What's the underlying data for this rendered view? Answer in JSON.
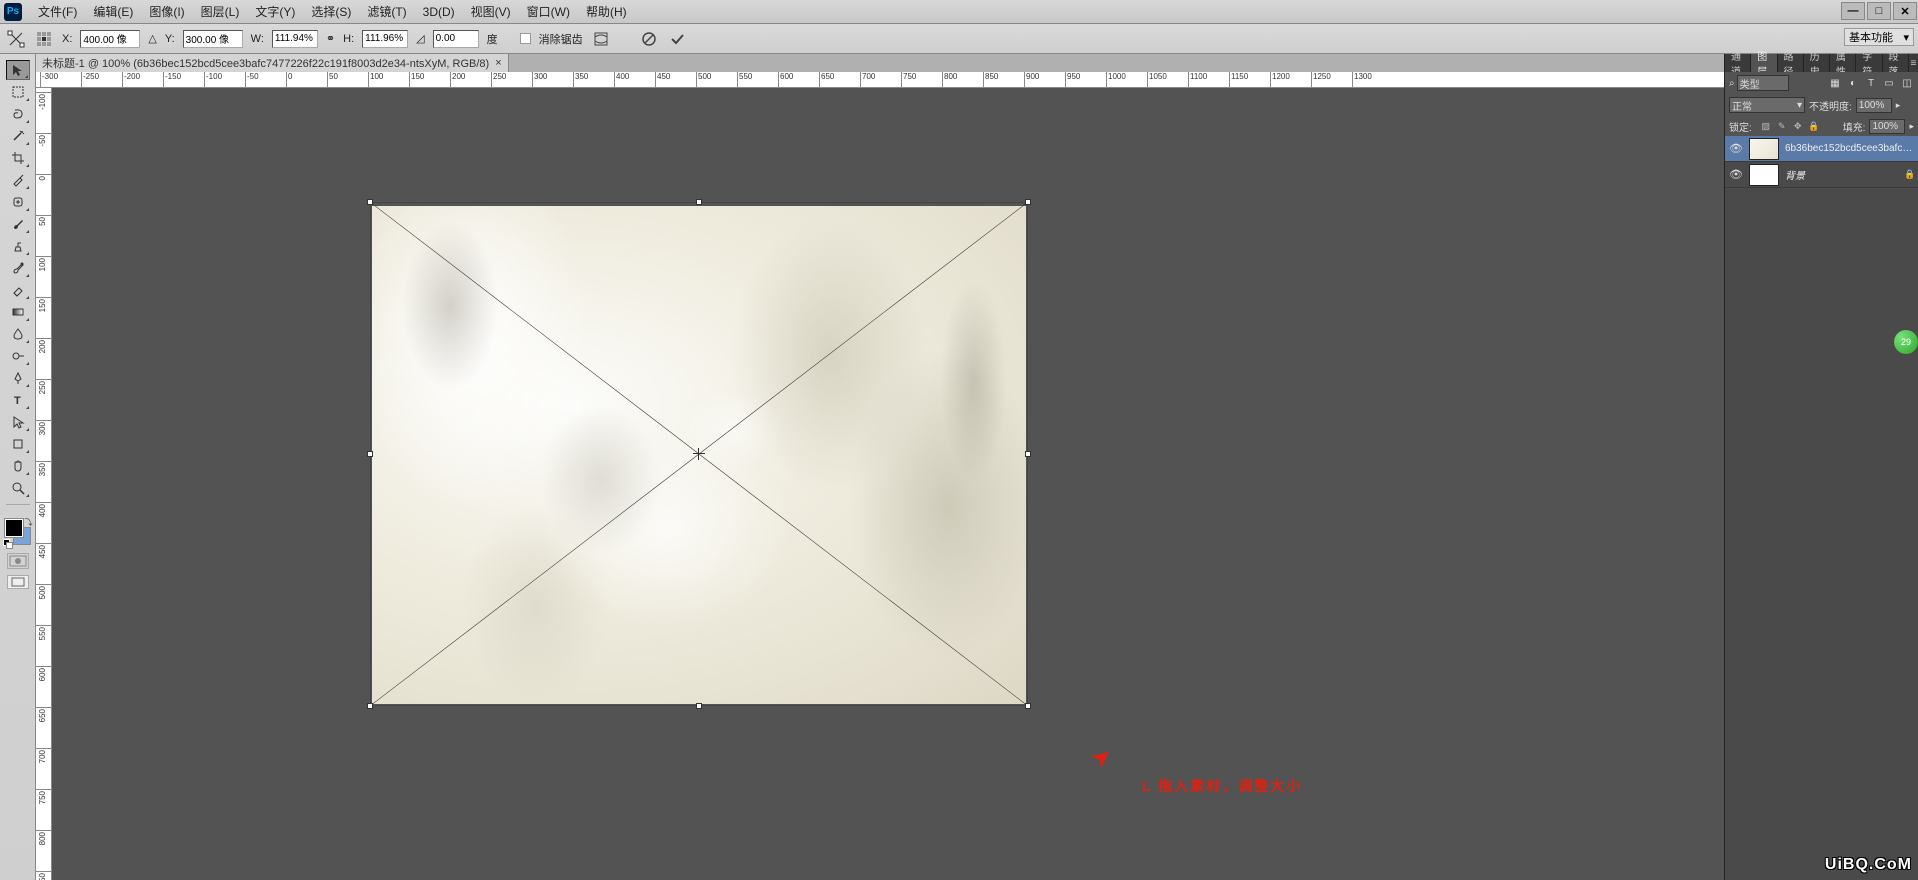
{
  "menubar": {
    "items": [
      "文件(F)",
      "编辑(E)",
      "图像(I)",
      "图层(L)",
      "文字(Y)",
      "选择(S)",
      "滤镜(T)",
      "3D(D)",
      "视图(V)",
      "窗口(W)",
      "帮助(H)"
    ]
  },
  "optionsbar": {
    "x_label": "X:",
    "x_value": "400.00 像",
    "y_label": "Y:",
    "y_value": "300.00 像",
    "w_label": "W:",
    "w_value": "111.94%",
    "h_label": "H:",
    "h_value": "111.96%",
    "angle_value": "0.00",
    "angle_unit": "度",
    "antialias_label": "消除锯齿",
    "workspace": "基本功能"
  },
  "doctab": {
    "title": "未标题-1 @ 100% (6b36bec152bcd5cee3bafc7477226f22c191f8003d2e34-ntsXyM, RGB/8)"
  },
  "ruler": {
    "marks": [
      "-300",
      "-250",
      "-200",
      "-150",
      "-100",
      "-50",
      "0",
      "50",
      "100",
      "150",
      "200",
      "250",
      "300",
      "350",
      "400",
      "450",
      "500",
      "550",
      "600",
      "650",
      "700",
      "750",
      "800",
      "850",
      "900",
      "950",
      "1000",
      "1050",
      "1100",
      "1150",
      "1200",
      "1250",
      "1300"
    ]
  },
  "panels": {
    "tabrow1": [
      "通道",
      "图层",
      "路径",
      "历史",
      "属性",
      "字符",
      "段落"
    ],
    "active_tab": "图层",
    "filter_type": "类型",
    "blend_mode": "正常",
    "opacity_label": "不透明度:",
    "opacity_value": "100%",
    "lock_label": "锁定:",
    "fill_label": "填充:",
    "fill_value": "100%",
    "layers": [
      {
        "name": "6b36bec152bcd5cee3bafc7...",
        "selected": true,
        "visible": true,
        "locked": false
      },
      {
        "name": "背景",
        "selected": false,
        "visible": true,
        "locked": true
      }
    ]
  },
  "annotation": {
    "text": "L 拖入素材，调整大小"
  },
  "watermark": "UiBQ.CoM",
  "bubble": "29"
}
